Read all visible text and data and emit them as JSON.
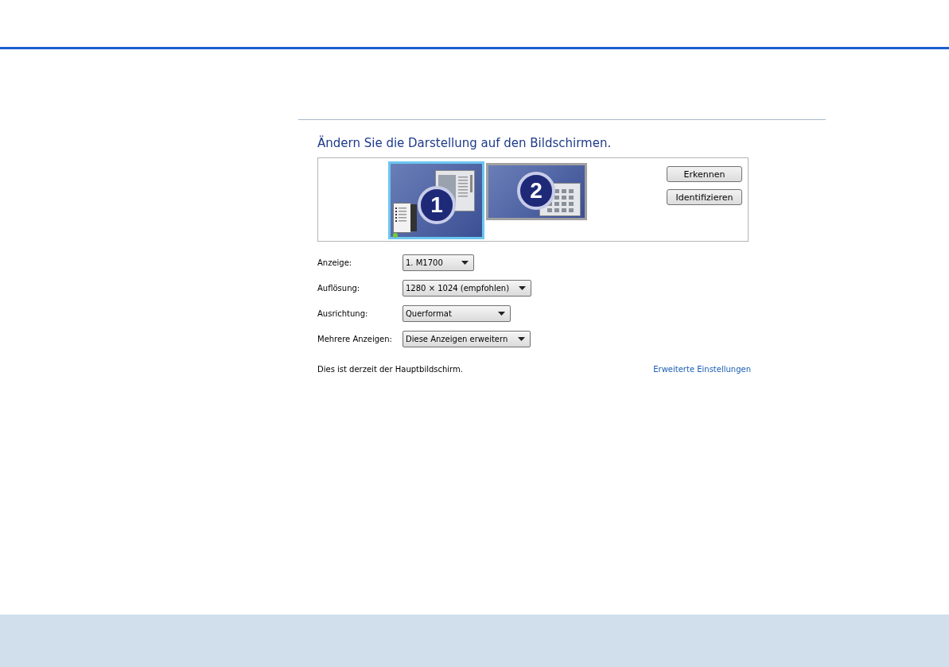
{
  "heading": "Ändern Sie die Darstellung auf den Bildschirmen.",
  "monitors": [
    {
      "number": "1",
      "selected": true,
      "kind": "primary"
    },
    {
      "number": "2",
      "selected": false,
      "kind": "secondary"
    }
  ],
  "buttons": [
    "Erkennen",
    "Identifizieren"
  ],
  "settings": [
    {
      "label": "Anzeige:",
      "value": "1. M1700"
    },
    {
      "label": "Auflösung:",
      "value": "1280 × 1024 (empfohlen)"
    },
    {
      "label": "Ausrichtung:",
      "value": "Querformat"
    },
    {
      "label": "Mehrere Anzeigen:",
      "value": "Diese Anzeigen erweitern"
    }
  ],
  "status_text": "Dies ist derzeit der Hauptbildschirm.",
  "advanced_link": "Erweiterte Einstellungen"
}
